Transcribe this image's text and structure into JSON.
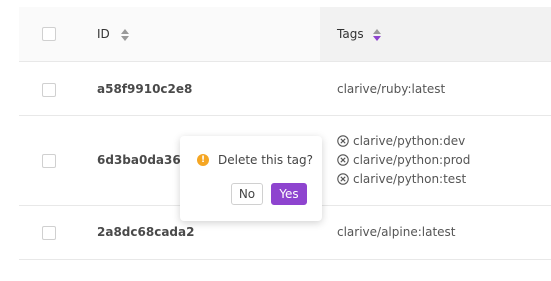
{
  "table": {
    "columns": {
      "id": "ID",
      "tags": "Tags"
    },
    "rows": [
      {
        "id": "a58f9910c2e8",
        "tags": [
          "clarive/ruby:latest"
        ]
      },
      {
        "id": "6d3ba0da369",
        "tags": [
          "clarive/python:dev",
          "clarive/python:prod",
          "clarive/python:test"
        ]
      },
      {
        "id": "2a8dc68cada2",
        "tags": [
          "clarive/alpine:latest"
        ]
      }
    ]
  },
  "popconfirm": {
    "message": "Delete this tag?",
    "no_label": "No",
    "yes_label": "Yes",
    "warning_glyph": "!",
    "icon": "warning-icon"
  },
  "colors": {
    "accent": "#8e44cf",
    "warning": "#f5a623",
    "header_bg": "#fafafa",
    "sorted_column_bg": "#f2f2f2"
  }
}
